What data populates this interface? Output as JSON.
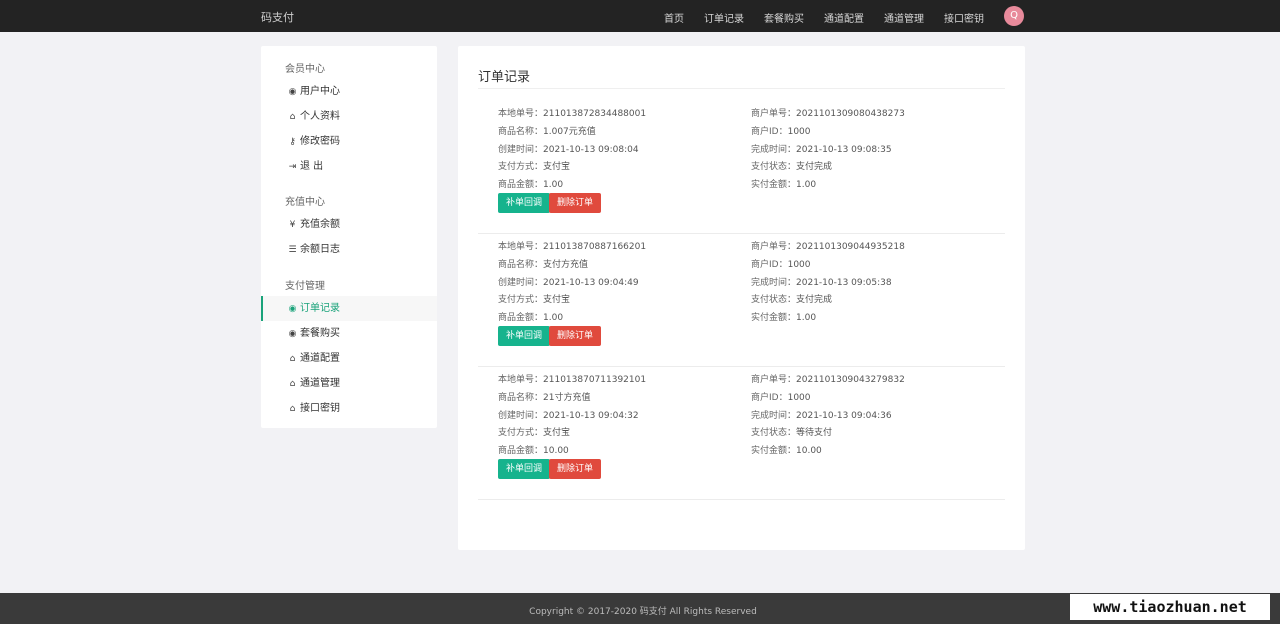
{
  "header": {
    "brand": "码支付",
    "nav": [
      "首页",
      "订单记录",
      "套餐购买",
      "通道配置",
      "通道管理",
      "接口密钥"
    ],
    "avatar_letter": "Q",
    "avatar_color": "#e88a9b"
  },
  "sidebar": {
    "groups": [
      {
        "title": "会员中心",
        "items": [
          {
            "icon": "user-circle-icon",
            "glyph": "◉",
            "label": "用户中心"
          },
          {
            "icon": "lock-icon",
            "glyph": "⌂",
            "label": "个人资料"
          },
          {
            "icon": "key-icon",
            "glyph": "⚷",
            "label": "修改密码"
          },
          {
            "icon": "logout-icon",
            "glyph": "⇥",
            "label": "退 出"
          }
        ]
      },
      {
        "title": "充值中心",
        "items": [
          {
            "icon": "yen-icon",
            "glyph": "¥",
            "label": "充值余额"
          },
          {
            "icon": "list-icon",
            "glyph": "☰",
            "label": "余额日志"
          }
        ]
      },
      {
        "title": "支付管理",
        "items": [
          {
            "icon": "user-circle-icon",
            "glyph": "◉",
            "label": "订单记录",
            "active": true
          },
          {
            "icon": "user-circle-icon",
            "glyph": "◉",
            "label": "套餐购买"
          },
          {
            "icon": "lock-icon",
            "glyph": "⌂",
            "label": "通道配置"
          },
          {
            "icon": "lock-icon",
            "glyph": "⌂",
            "label": "通道管理"
          },
          {
            "icon": "lock-icon",
            "glyph": "⌂",
            "label": "接口密钥"
          }
        ]
      }
    ]
  },
  "main": {
    "title": "订单记录",
    "labels": {
      "local_no": "本地单号：",
      "product": "商品名称：",
      "created": "创建时间：",
      "pay_method": "支付方式：",
      "amount": "商品金额：",
      "merchant_no": "商户单号：",
      "merchant_id": "商户ID：",
      "finished": "完成时间：",
      "pay_status": "支付状态：",
      "paid": "实付金额："
    },
    "btn_callback": "补单回调",
    "btn_delete": "删除订单",
    "orders": [
      {
        "local_no": "211013872834488001",
        "product": "1.007元充值",
        "created": "2021-10-13 09:08:04",
        "pay_method": "支付宝",
        "amount": "1.00",
        "merchant_no": "2021101309080438273",
        "merchant_id": "1000",
        "finished": "2021-10-13 09:08:35",
        "pay_status": "支付完成",
        "paid": "1.00"
      },
      {
        "local_no": "211013870887166201",
        "product": "支付方充值",
        "created": "2021-10-13 09:04:49",
        "pay_method": "支付宝",
        "amount": "1.00",
        "merchant_no": "2021101309044935218",
        "merchant_id": "1000",
        "finished": "2021-10-13 09:05:38",
        "pay_status": "支付完成",
        "paid": "1.00"
      },
      {
        "local_no": "211013870711392101",
        "product": "21寸方充值",
        "created": "2021-10-13 09:04:32",
        "pay_method": "支付宝",
        "amount": "10.00",
        "merchant_no": "2021101309043279832",
        "merchant_id": "1000",
        "finished": "2021-10-13 09:04:36",
        "pay_status": "等待支付",
        "paid": "10.00"
      }
    ]
  },
  "footer": {
    "copyright": "Copyright © 2017-2020 码支付 All Rights Reserved",
    "watermark": "www.tiaozhuan.net"
  }
}
